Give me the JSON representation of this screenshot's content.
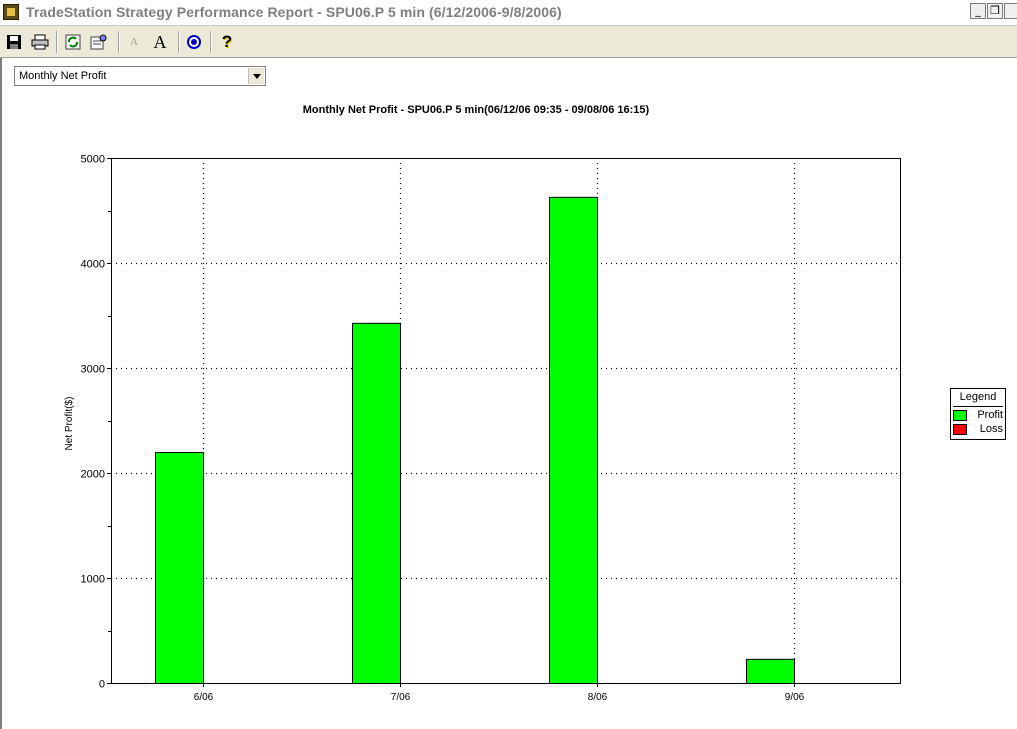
{
  "window": {
    "title": "TradeStation Strategy Performance Report - SPU06.P 5 min (6/12/2006-9/8/2006)",
    "minimize_glyph": "_",
    "restore_glyph": "❐",
    "icon": "tradestation-app-icon"
  },
  "toolbar": {
    "buttons": [
      {
        "name": "save",
        "icon": "floppy-disk-icon"
      },
      {
        "name": "print",
        "icon": "printer-icon"
      },
      {
        "name": "refresh",
        "icon": "refresh-icon"
      },
      {
        "name": "properties",
        "icon": "report-properties-icon"
      },
      {
        "name": "decrease-font",
        "icon": "font-decrease-icon",
        "label": "A"
      },
      {
        "name": "increase-font",
        "icon": "font-increase-icon",
        "label": "A"
      },
      {
        "name": "target",
        "icon": "target-icon"
      },
      {
        "name": "help",
        "icon": "help-icon",
        "label": "?"
      }
    ]
  },
  "report_select": {
    "value": "Monthly Net Profit"
  },
  "colors": {
    "profit": "#00ff00",
    "loss": "#ff0000"
  },
  "legend": {
    "title": "Legend",
    "items": [
      {
        "label": "Profit",
        "color": "#00ff00"
      },
      {
        "label": "Loss",
        "color": "#ff0000"
      }
    ]
  },
  "chart_data": {
    "type": "bar",
    "title": "Monthly Net Profit - SPU06.P 5 min(06/12/06 09:35 - 09/08/06 16:15)",
    "xlabel": "",
    "ylabel": "Net Profit($)",
    "categories": [
      "6/06",
      "7/06",
      "8/06",
      "9/06"
    ],
    "values": [
      2200,
      3430,
      4630,
      230
    ],
    "ylim": [
      0,
      5000
    ],
    "yticks": [
      0,
      1000,
      2000,
      3000,
      4000,
      5000
    ],
    "grid": true,
    "legend_position": "right"
  }
}
